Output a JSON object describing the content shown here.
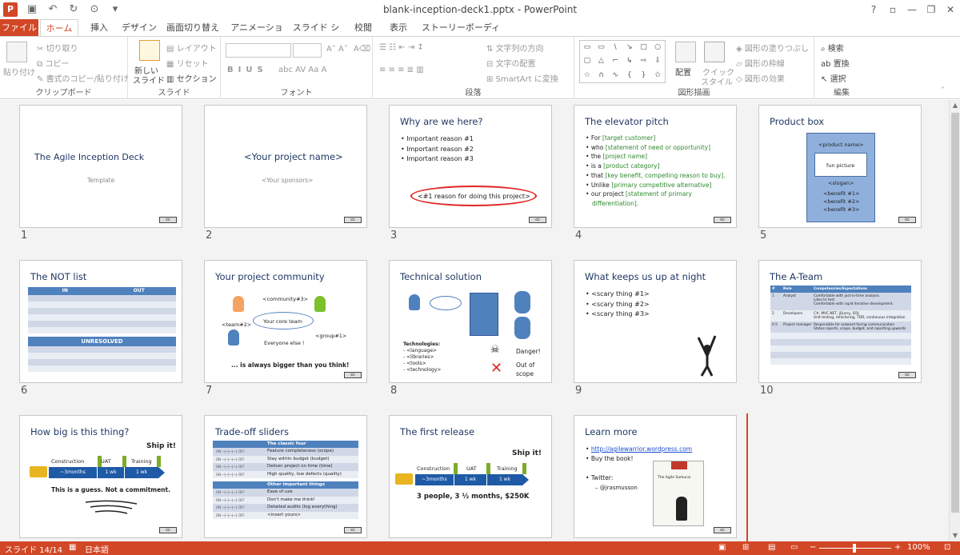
{
  "window": {
    "title": "blank-inception-deck1.pptx - PowerPoint",
    "help": "?",
    "minimize": "—",
    "close": "✕"
  },
  "tabs": [
    "ファイル",
    "ホーム",
    "挿入",
    "デザイン",
    "画面切り替え",
    "アニメーション",
    "スライド ショー",
    "校閲",
    "表示",
    "ストーリーボーディング"
  ],
  "ribbon": {
    "clipboard": {
      "label": "クリップボード",
      "paste": "貼り付け",
      "cut": "切り取り",
      "copy": "コピー",
      "format_painter": "書式のコピー/貼り付け"
    },
    "slides": {
      "label": "スライド",
      "new_slide": "新しい",
      "new_slide2": "スライド",
      "layout": "レイアウト",
      "reset": "リセット",
      "section": "セクション"
    },
    "font": {
      "label": "フォント"
    },
    "paragraph": {
      "label": "段落",
      "text_direction": "文字列の方向",
      "align_text": "文字の配置",
      "smartart": "SmartArt に変換"
    },
    "drawing": {
      "label": "図形描画",
      "arrange": "配置",
      "quick_styles": "クイック",
      "quick_styles2": "スタイル",
      "shape_fill": "図形の塗りつぶし",
      "shape_outline": "図形の枠線",
      "shape_effects": "図形の効果"
    },
    "editing": {
      "label": "編集",
      "find": "検索",
      "replace": "置換",
      "select": "選択"
    }
  },
  "slides": {
    "s1": {
      "num": "1",
      "title": "The Agile Inception Deck",
      "sub": "Template"
    },
    "s2": {
      "num": "2",
      "title": "<Your project name>",
      "sub": "<Your sponsors>"
    },
    "s3": {
      "num": "3",
      "title": "Why are we here?",
      "b1": "Important reason #1",
      "b2": "Important reason #2",
      "b3": "Important reason #3",
      "callout": "<#1 reason for doing this project>"
    },
    "s4": {
      "num": "4",
      "title": "The elevator pitch",
      "l1a": "For ",
      "l1b": "[target customer]",
      "l2a": "who ",
      "l2b": "[statement of need or opportunity]",
      "l3a": "the ",
      "l3b": "[project name]",
      "l4a": "is a ",
      "l4b": "[product category]",
      "l5a": "that ",
      "l5b": "[key benefit, compelling reason to buy].",
      "l6a": "Unlike ",
      "l6b": "[primary competitive alternative]",
      "l7a": "our project ",
      "l7b": "[statement of primary",
      "l7c": "differentiation]."
    },
    "s5": {
      "num": "5",
      "title": "Product box",
      "name": "<product name>",
      "pic": "fun picture",
      "slogan": "<slogan>",
      "b1": "<benefit #1>",
      "b2": "<benefit #2>",
      "b3": "<benefit #3>"
    },
    "s6": {
      "num": "6",
      "title": "The NOT list",
      "in": "IN",
      "out": "OUT",
      "unresolved": "UNRESOLVED"
    },
    "s7": {
      "num": "7",
      "title": "Your project community",
      "c3": "<community#3>",
      "t2": "<team#2>",
      "core": "Your core team",
      "g1": "<group#1>",
      "else": "Everyone else !",
      "bottom": "... is always bigger than you think!"
    },
    "s8": {
      "num": "8",
      "title": "Technical solution",
      "tech": "Technologies:",
      "t1": "- <language>",
      "t2": "- <libraries>",
      "t3": "- <tools>",
      "t4": "- <technology>",
      "danger": "Danger!",
      "out1": "Out of",
      "out2": "scope"
    },
    "s9": {
      "num": "9",
      "title": "What keeps us up at night",
      "b1": "<scary thing #1>",
      "b2": "<scary thing #2>",
      "b3": "<scary thing #3>"
    },
    "s10": {
      "num": "10",
      "title": "The A-Team",
      "h1": "#",
      "h2": "Role",
      "h3": "Competencies/Expectations",
      "r1a": "1",
      "r1b": "Analyst",
      "r1c": "Comfortable with just-in-time analysis.",
      "r1d": "Likes to test.",
      "r1e": "Comfortable with rapid iterative development.",
      "r2a": "2",
      "r2b": "Developers",
      "r2c": "C#, MVC.NET, jQuery, SQL",
      "r2d": "Unit testing, refactoring, TDD, continuous integration",
      "r3a": "0.5",
      "r3b": "Project manager",
      "r3c": "Responsible for outward facing communication",
      "r3d": "Status reports, scope, budget, and reporting upwards"
    },
    "s11": {
      "num": "",
      "title": "How big is this thing?",
      "ship": "Ship it!",
      "construction": "Construction",
      "uat": "UAT",
      "training": "Training",
      "m3": "~3months",
      "w1": "1 wk",
      "w2": "1 wk",
      "guess": "This is a guess. Not a commitment."
    },
    "s12": {
      "num": "",
      "title": "Trade-off sliders",
      "h1": "The classic four",
      "f1": "Feature completeness (scope)",
      "f2": "Stay within budget (budget)",
      "f3": "Deliver project on time (time)",
      "f4": "High quality, low defects (quality)",
      "h2": "Other important things",
      "o1": "Ease of use",
      "o2": "Don't make me think!",
      "o3": "Detailed audits (log everything)",
      "o4": "<insert yours>",
      "on": "ON",
      "off": "OFF"
    },
    "s13": {
      "num": "",
      "title": "The first release",
      "ship": "Ship it!",
      "construction": "Construction",
      "uat": "UAT",
      "training": "Training",
      "m3": "~3months",
      "w1": "1 wk",
      "w2": "1 wk",
      "summary": "3 people, 3 ½ months, $250K"
    },
    "s14": {
      "num": "",
      "title": "Learn more",
      "link": "http://agilewarrior.wordpress.com",
      "buy": "Buy the book!",
      "twitter": "Twitter:",
      "handle": "– @jrasmusson",
      "book": "The Agile Samurai"
    }
  },
  "status": {
    "slide": "スライド 14/14",
    "lang": "日本語",
    "zoom": "100%"
  }
}
